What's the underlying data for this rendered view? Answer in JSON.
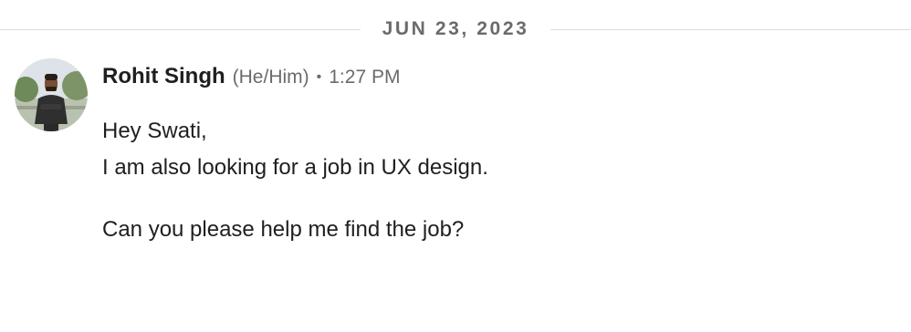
{
  "date_divider": {
    "label": "JUN 23, 2023"
  },
  "message": {
    "sender_name": "Rohit Singh",
    "pronouns": "(He/Him)",
    "separator": "•",
    "time": "1:27 PM",
    "lines": [
      "Hey Swati,",
      "I am also looking for a job in UX design.",
      "",
      "Can you please help me find the job?"
    ]
  }
}
